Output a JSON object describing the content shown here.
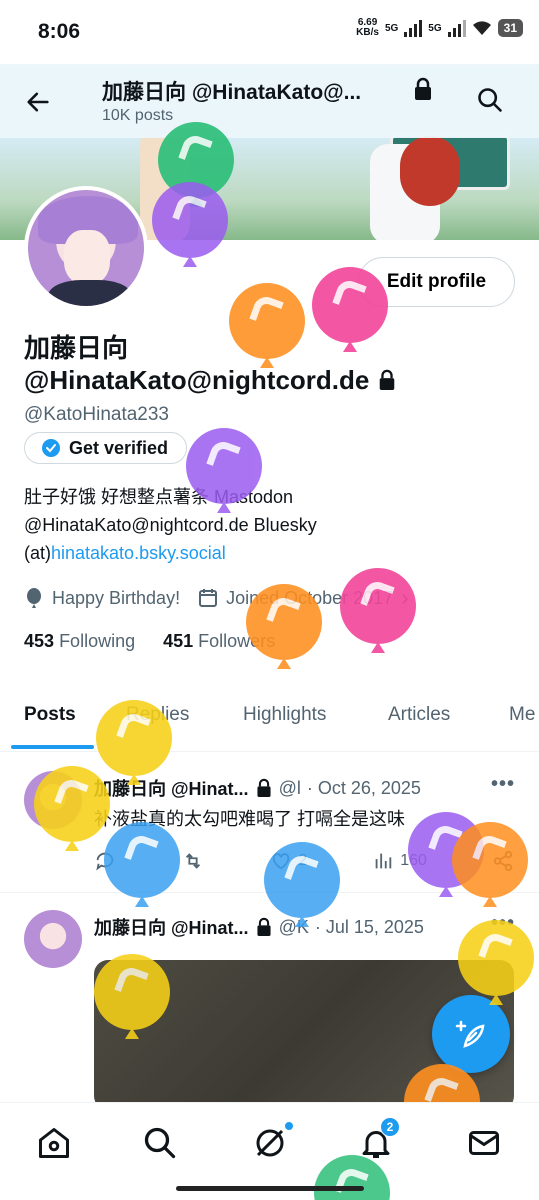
{
  "status": {
    "time": "8:06",
    "net_speed_top": "6.69",
    "net_speed_unit": "KB/s",
    "net1": "5G",
    "net2": "5G",
    "battery": "31"
  },
  "header": {
    "title": "加藤日向 @HinataKato@...",
    "subtitle": "10K posts"
  },
  "profile": {
    "edit_label": "Edit profile",
    "name_line1": "加藤日向",
    "name_line2": "@HinataKato@nightcord.de",
    "handle": "@KatoHinata233",
    "verified_label": "Get verified",
    "bio_line1": "肚子好饿 好想整点薯条 Mastodon",
    "bio_line2": "@HinataKato@nightcord.de Bluesky",
    "bio_line3_prefix": "(at)",
    "bio_link": "hinatakato.bsky.social",
    "birthday": "Happy Birthday!",
    "joined": "Joined October 2017",
    "following_count": "453",
    "following_label": "Following",
    "followers_count": "451",
    "followers_label": "Followers"
  },
  "tabs": [
    {
      "label": "Posts"
    },
    {
      "label": "Replies"
    },
    {
      "label": "Highlights"
    },
    {
      "label": "Articles"
    },
    {
      "label": "Me"
    }
  ],
  "posts": [
    {
      "name": "加藤日向 @Hinat...",
      "handle": "@l",
      "date": "· Oct 26, 2025",
      "text": "补液盐真的太勾吧难喝了 打嗝全是这味",
      "likes": "2",
      "views": "160"
    },
    {
      "name": "加藤日向 @Hinat...",
      "handle": "@K",
      "date": "· Jul 15, 2025"
    }
  ],
  "nav": {
    "notifications_badge": "2"
  },
  "colors": {
    "accent": "#1d9bf0",
    "balloon_green": "#2ebf7a",
    "balloon_purple": "#9b5cf0",
    "balloon_orange": "#ff8f1f",
    "balloon_pink": "#f2459a",
    "balloon_yellow": "#f7d117",
    "balloon_blue": "#3aa0f0"
  }
}
